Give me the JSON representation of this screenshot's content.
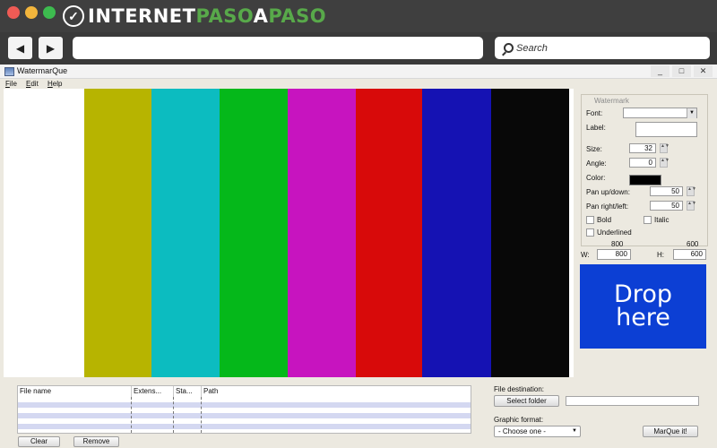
{
  "site": {
    "brand_part1": "INTERNET",
    "brand_part2": "PASO",
    "brand_part3": "A",
    "brand_part4": "PASO"
  },
  "browser": {
    "back_icon": "left-arrow-icon",
    "forward_icon": "right-arrow-icon",
    "url_value": "",
    "search_placeholder": "Search"
  },
  "app": {
    "title": "WatermarQue",
    "window_buttons": {
      "minimize": "_",
      "maximize": "□",
      "close": "✕"
    },
    "menu": [
      "File",
      "Edit",
      "Help"
    ]
  },
  "preview_bars": [
    {
      "color": "#ffffff"
    },
    {
      "color": "#b7b400"
    },
    {
      "color": "#0cbcc0"
    },
    {
      "color": "#05b81a"
    },
    {
      "color": "#c714bf"
    },
    {
      "color": "#d80a0a"
    },
    {
      "color": "#1512b3"
    },
    {
      "color": "#080808"
    }
  ],
  "watermark_panel": {
    "legend": "Watermark",
    "font_label": "Font:",
    "font_value": "",
    "label_label": "Label:",
    "label_value": "",
    "size_label": "Size:",
    "size_value": "32",
    "angle_label": "Angle:",
    "angle_value": "0",
    "color_label": "Color:",
    "color_value": "#000000",
    "pan_ud_label": "Pan up/down:",
    "pan_ud_value": "50",
    "pan_rl_label": "Pan right/left:",
    "pan_rl_value": "50",
    "bold_label": "Bold",
    "italic_label": "Italic",
    "underlined_label": "Underlined",
    "width_hint": "800",
    "height_hint": "600",
    "w_label": "W:",
    "w_value": "800",
    "h_label": "H:",
    "h_value": "600",
    "drop_line1": "Drop",
    "drop_line2": "here"
  },
  "file_table": {
    "columns": [
      "File name",
      "Extens...",
      "Sta...",
      "Path"
    ],
    "rows": []
  },
  "bottom": {
    "file_destination_label": "File destination:",
    "select_folder": "Select folder",
    "destination_value": "",
    "graphic_format_label": "Graphic format:",
    "format_value": "- Choose one -",
    "marque_button": "MarQue it!",
    "clear_button": "Clear",
    "remove_button": "Remove"
  }
}
